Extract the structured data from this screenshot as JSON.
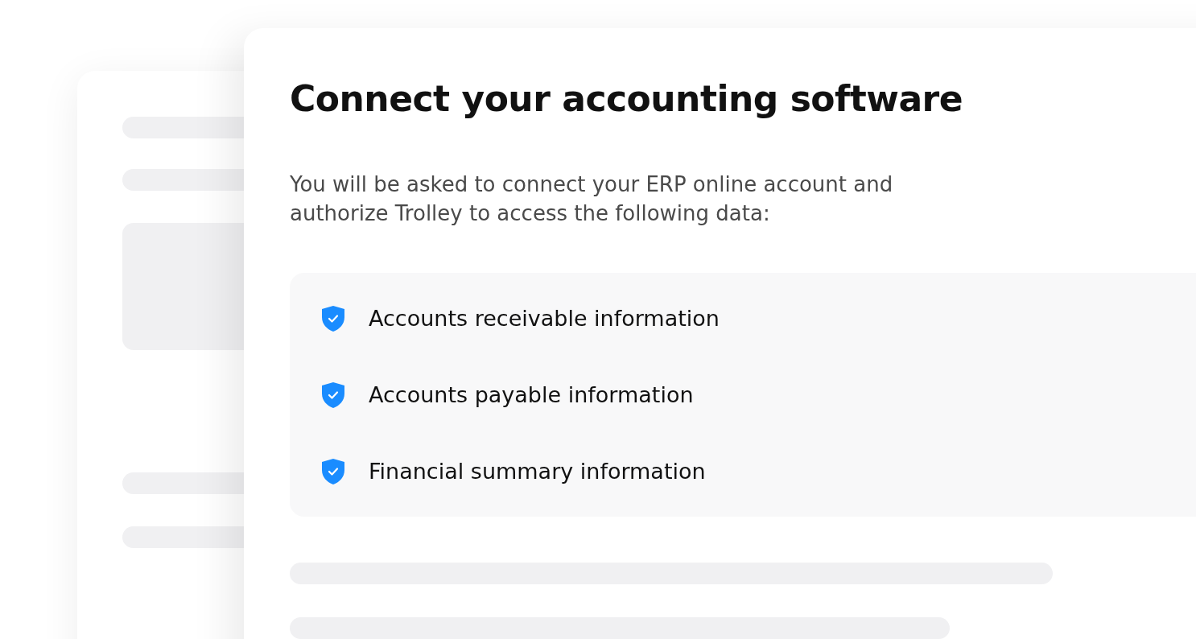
{
  "dialog": {
    "title": "Connect your accounting software",
    "description": "You will be asked to connect your ERP online account and authorize Trolley to access the following data:",
    "permissions": [
      {
        "label": "Accounts receivable information"
      },
      {
        "label": "Accounts payable information"
      },
      {
        "label": "Financial summary information"
      }
    ]
  }
}
